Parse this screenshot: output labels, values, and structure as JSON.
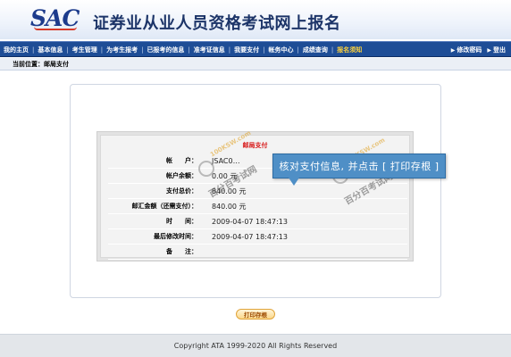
{
  "header": {
    "logo_text": "SAC",
    "site_title": "证券业从业人员资格考试网上报名"
  },
  "nav": {
    "items": [
      "我的主页",
      "基本信息",
      "考生管理",
      "为考生报考",
      "已报考的信息",
      "准考证信息",
      "我要支付",
      "帐务中心",
      "成绩查询",
      "报名须知"
    ],
    "separator": "|",
    "right": {
      "change_password": "修改密码",
      "logout": "登出"
    }
  },
  "breadcrumb": "当前位置：邮局支付",
  "payment": {
    "title": "邮局支付",
    "rows": [
      {
        "label": "帐　　户：",
        "value": "JSAC0…"
      },
      {
        "label": "帐户余额：",
        "value": "0.00 元"
      },
      {
        "label": "支付总价：",
        "value": "840.00 元"
      },
      {
        "label": "邮汇金额（还需支付）：",
        "value": "840.00 元"
      },
      {
        "label": "时　　间：",
        "value": "2009-04-07 18:47:13"
      },
      {
        "label": "最后修改时间：",
        "value": "2009-04-07 18:47:13"
      },
      {
        "label": "备　　注：",
        "value": ""
      }
    ]
  },
  "tooltip": "核对支付信息, 并点击 [ 打印存根 ]",
  "watermark": {
    "text": "百分百考试网",
    "site": "100KSW.com"
  },
  "print_button": "打印存根",
  "footer": "Copyright ATA 1999-2020  All Rights Reserved",
  "colors": {
    "nav_bg": "#1e4d96",
    "accent_red": "#d71515",
    "tip_bg": "#4f8fc6",
    "nav_active": "#ffd23a"
  }
}
